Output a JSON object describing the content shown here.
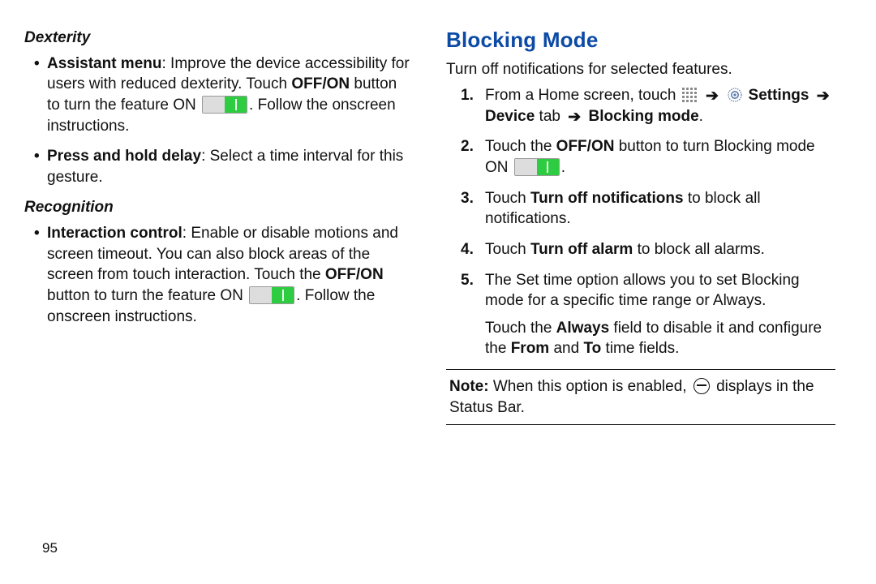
{
  "page_number": "95",
  "left": {
    "dexterity_heading": "Dexterity",
    "dexterity_items": [
      {
        "bold": "Assistant menu",
        "pre": ": Improve the device accessibility for users with reduced dexterity. Touch ",
        "innerBold": "OFF/ON",
        "mid": " button to turn the feature ON ",
        "post": ". Follow the onscreen instructions."
      },
      {
        "bold": "Press and hold delay",
        "rest": ": Select a time interval for this gesture."
      }
    ],
    "recognition_heading": "Recognition",
    "recognition_item": {
      "bold": "Interaction control",
      "pre": ": Enable or disable motions and screen timeout. You can also block areas of the screen from touch interaction. Touch the ",
      "innerBold": "OFF/ON",
      "mid": " button to turn the feature ON ",
      "post": ". Follow the onscreen instructions."
    }
  },
  "right": {
    "heading": "Blocking Mode",
    "intro": "Turn off notifications for selected features.",
    "steps": {
      "s1": {
        "pre": "From a Home screen, touch ",
        "settings": "Settings",
        "device": "Device",
        "tab_word": " tab ",
        "blocking": "Blocking mode",
        "period": "."
      },
      "s2": {
        "pre": "Touch the ",
        "offon": "OFF/ON",
        "mid": " button to turn Blocking mode ON ",
        "period": "."
      },
      "s3": {
        "pre": "Touch ",
        "bold": "Turn off notifications",
        "post": " to block all notifications."
      },
      "s4": {
        "pre": "Touch ",
        "bold": "Turn off alarm",
        "post": " to block all alarms."
      },
      "s5": {
        "main": "The Set time option allows you to set Blocking mode for a specific time range or Always.",
        "sub_pre": "Touch the ",
        "always": "Always",
        "sub_mid": " field to disable it and configure the ",
        "from": "From",
        "and": " and ",
        "to": "To",
        "sub_post": " time fields."
      }
    },
    "note": {
      "label": "Note:",
      "pre": " When this option is enabled, ",
      "post": " displays in the Status Bar."
    }
  }
}
